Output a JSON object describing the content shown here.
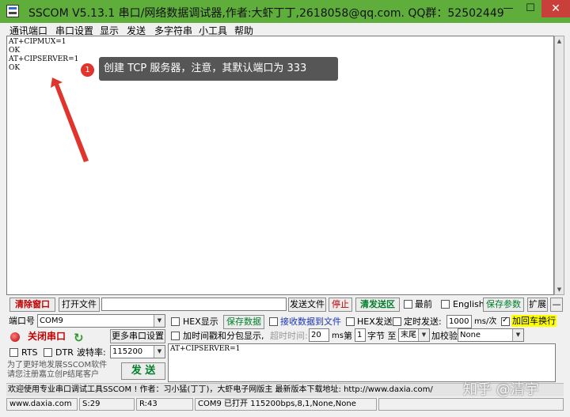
{
  "window": {
    "title": "SSCOM V5.13.1 串口/网络数据调试器,作者:大虾丁丁,2618058@qq.com. QQ群：52502449",
    "min_glyph": "—",
    "max_glyph": "☐",
    "close_glyph": "✕"
  },
  "menu": [
    "通讯端口",
    "串口设置",
    "显示",
    "发送",
    "多字符串",
    "小工具",
    "帮助"
  ],
  "terminal": {
    "lines": [
      "AT+CIPMUX=1",
      "",
      "OK",
      "AT+CIPSERVER=1",
      "",
      "OK"
    ]
  },
  "annotation": {
    "badge": "1",
    "text": "创建 TCP 服务器，注意，其默认端口为 333"
  },
  "toolbar": {
    "clear_window": "清除窗口",
    "open_file": "打开文件",
    "open_file_path": "",
    "send_file": "发送文件",
    "stop": "停止",
    "clear_send": "清发送区",
    "topmost": "最前",
    "english": "English",
    "save_params": "保存参数",
    "expand": "扩展",
    "collapse": "—"
  },
  "port": {
    "label": "端口号",
    "value": "COM9",
    "close_port": "关闭串口",
    "more_settings": "更多串口设置",
    "rts": "RTS",
    "dtr": "DTR",
    "baud_label": "波特率:",
    "baud_value": "115200",
    "promo": "为了更好地发展SSCOM软件",
    "promo2": "请您注册嘉立创P结尾客户",
    "send": "发 送"
  },
  "options": {
    "hex_display": "HEX显示",
    "save_data": "保存数据",
    "recv_to_file": "接收数据到文件",
    "hex_send": "HEX发送",
    "timed_send": "定时发送:",
    "interval": "1000",
    "interval_unit": "ms/次",
    "add_crlf": "加回车换行",
    "timestamp": "加时间戳和分包显示,",
    "timeout_label": "超时时间:",
    "timeout_value": "20",
    "timeout_unit": "ms",
    "nth_label": "第",
    "nth_value": "1",
    "byte_to": "字节 至",
    "end_value": "末尾",
    "checksum_label": "加校验",
    "checksum_value": "None"
  },
  "send_text": "AT+CIPSERVER=1",
  "info_bar": "欢迎使用专业串口调试工具SSCOM !  作者：习小猛(丁丁)，大虾电子网版主  最新版本下载地址: http://www.daxia.com/",
  "status": {
    "site": "www.daxia.com",
    "sent": "S:29",
    "recv": "R:43",
    "port_state": "COM9 已打开  115200bps,8,1,None,None"
  },
  "watermark": "知乎 @清宇",
  "colors": {
    "titlebar": "#5fae3c",
    "annotation_badge": "#e0342c",
    "annotation_box": "#565656",
    "arrow": "#e0342c"
  }
}
